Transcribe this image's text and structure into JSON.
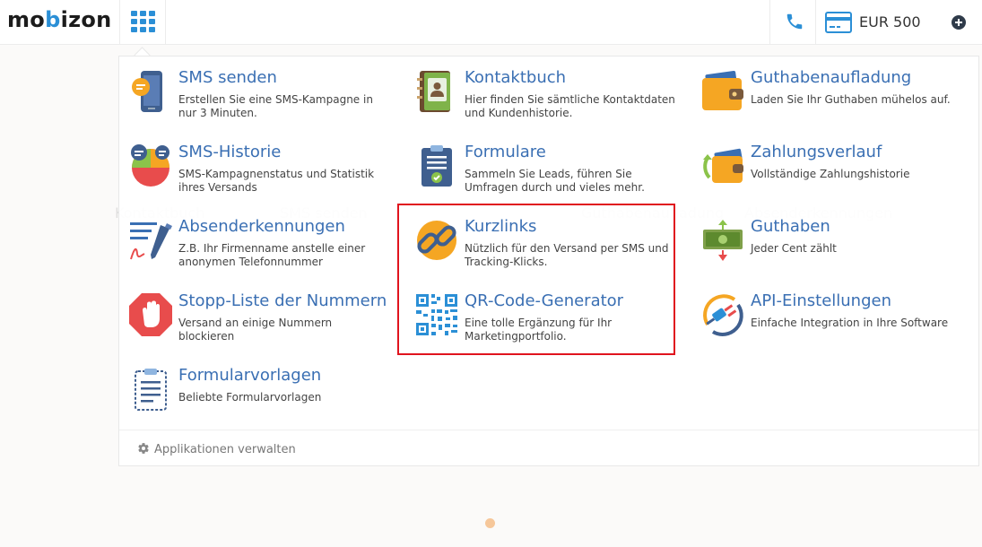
{
  "header": {
    "logo_left": "mo",
    "logo_b": "b",
    "logo_right": "izon",
    "apps_icon": "grid-icon",
    "phone_icon": "phone-icon",
    "balance_icon": "credit-card-icon",
    "balance": "EUR 500",
    "add_icon": "plus-circle-icon"
  },
  "background": {
    "labels": [
      "Kontaktbuch",
      "SMS senden",
      "Guthabenaufladung",
      "Absenderkennungen"
    ]
  },
  "apps": [
    {
      "title": "SMS senden",
      "desc": "Erstellen Sie eine SMS-Kampagne in nur 3 Minuten.",
      "icon": "phone-sms-icon"
    },
    {
      "title": "Kontaktbuch",
      "desc": "Hier finden Sie sämtliche Kontaktdaten und Kundenhistorie.",
      "icon": "contact-book-icon"
    },
    {
      "title": "Guthabenaufladung",
      "desc": "Laden Sie Ihr Guthaben mühelos auf.",
      "icon": "wallet-icon"
    },
    {
      "title": "SMS-Historie",
      "desc": "SMS-Kampagnenstatus und Statistik ihres Versands",
      "icon": "pie-chart-icon"
    },
    {
      "title": "Formulare",
      "desc": "Sammeln Sie Leads, führen Sie Umfragen durch und vieles mehr.",
      "icon": "clipboard-form-icon"
    },
    {
      "title": "Zahlungsverlauf",
      "desc": "Vollständige Zahlungshistorie",
      "icon": "wallet-history-icon"
    },
    {
      "title": "Absenderkennungen",
      "desc": "Z.B. Ihr Firmenname anstelle einer anonymen Telefonnummer",
      "icon": "signature-pen-icon"
    },
    {
      "title": "Kurzlinks",
      "desc": "Nützlich für den Versand per SMS und Tracking-Klicks.",
      "icon": "link-icon"
    },
    {
      "title": "Guthaben",
      "desc": "Jeder Cent zählt",
      "icon": "money-icon"
    },
    {
      "title": "Stopp-Liste der Nummern",
      "desc": "Versand an einige Nummern blockieren",
      "icon": "stop-hand-icon"
    },
    {
      "title": "QR-Code-Generator",
      "desc": "Eine tolle Ergänzung für Ihr Marketingportfolio.",
      "icon": "qr-code-icon"
    },
    {
      "title": "API-Einstellungen",
      "desc": "Einfache Integration in Ihre Software",
      "icon": "api-plug-icon"
    },
    {
      "title": "Formularvorlagen",
      "desc": "Beliebte Formularvorlagen",
      "icon": "form-template-icon"
    }
  ],
  "footer": {
    "manage_label": "Applikationen verwalten",
    "manage_icon": "gear-icon"
  },
  "colors": {
    "title": "#3a6fb3",
    "highlight": "#e0141e",
    "brand_blue": "#2b8fd6"
  }
}
